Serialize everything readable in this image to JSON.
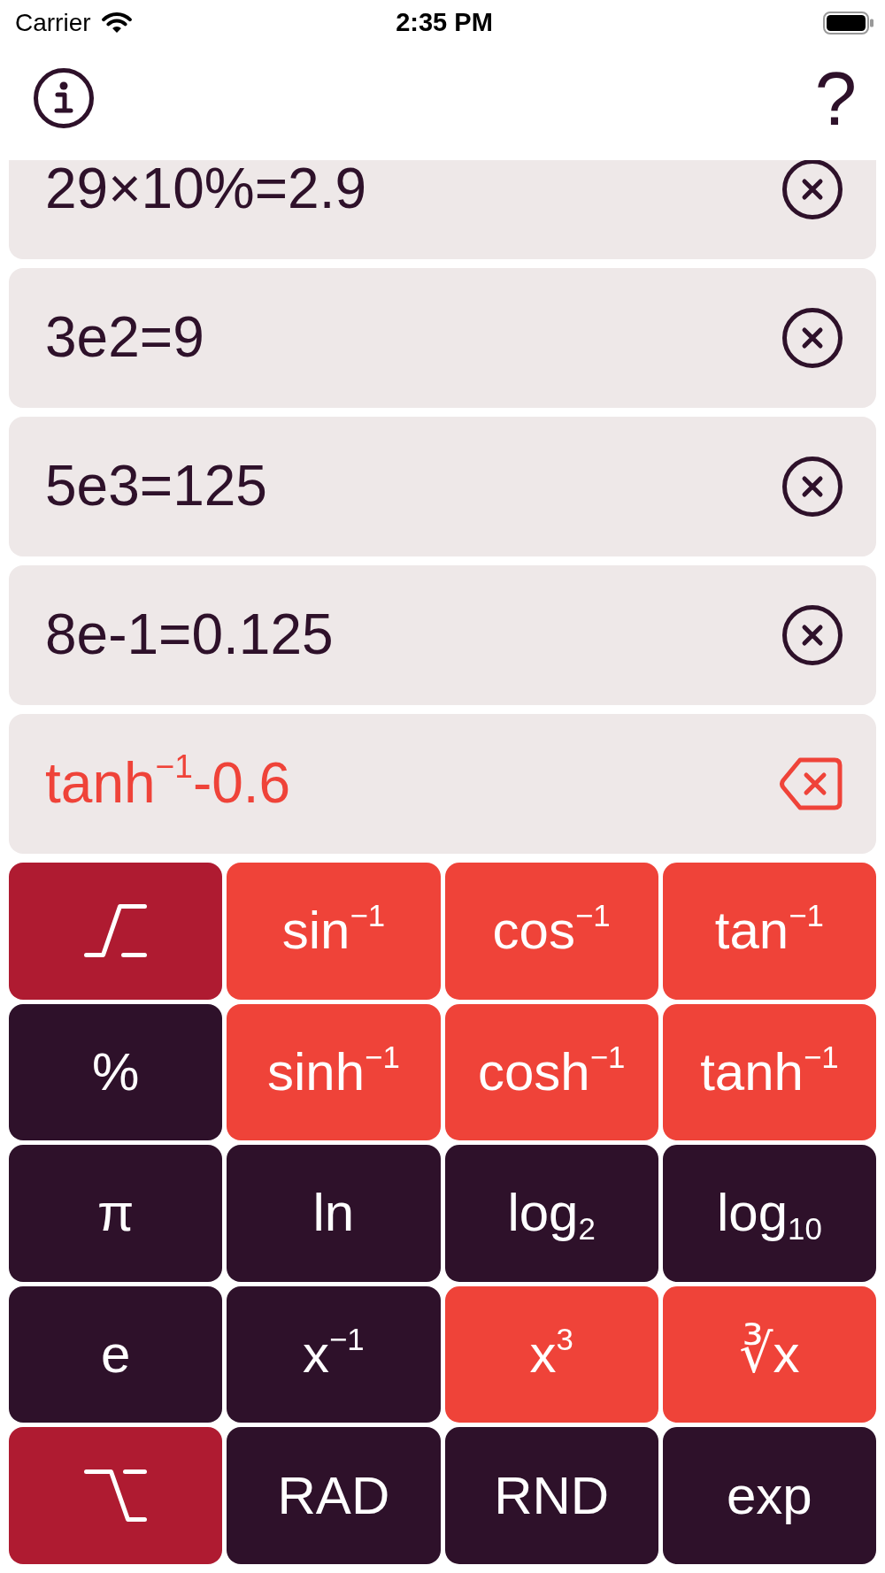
{
  "status_bar": {
    "carrier": "Carrier",
    "time": "2:35 PM"
  },
  "header": {
    "help": "?"
  },
  "history": [
    {
      "expression": "29×10%=2.9"
    },
    {
      "expression": "3e2=9"
    },
    {
      "expression": "5e3=125"
    },
    {
      "expression": "8e-1=0.125"
    }
  ],
  "input": {
    "expression": "tanh$^{−1}$-0.6"
  },
  "keypad": {
    "keys": [
      {
        "kind": "shift",
        "color": "#AF1B31"
      },
      {
        "kind": "text",
        "label": "sin$^{−1}$",
        "color": "#EF4339"
      },
      {
        "kind": "text",
        "label": "cos$^{−1}$",
        "color": "#EF4339"
      },
      {
        "kind": "text",
        "label": "tan$^{−1}$",
        "color": "#EF4339"
      },
      {
        "kind": "text",
        "label": "%",
        "color": "#2E112A"
      },
      {
        "kind": "text",
        "label": "sinh$^{−1}$",
        "color": "#EF4339"
      },
      {
        "kind": "text",
        "label": "cosh$^{−1}$",
        "color": "#EF4339"
      },
      {
        "kind": "text",
        "label": "tanh$^{−1}$",
        "color": "#EF4339"
      },
      {
        "kind": "text",
        "label": "π",
        "color": "#2E112A"
      },
      {
        "kind": "text",
        "label": "ln",
        "color": "#2E112A"
      },
      {
        "kind": "text",
        "label": "log$_{2}$",
        "color": "#2E112A"
      },
      {
        "kind": "text",
        "label": "log$_{10}$",
        "color": "#2E112A"
      },
      {
        "kind": "text",
        "label": "e",
        "color": "#2E112A"
      },
      {
        "kind": "text",
        "label": "x$^{−1}$",
        "color": "#2E112A"
      },
      {
        "kind": "text",
        "label": "x$^{3}$",
        "color": "#EF4339"
      },
      {
        "kind": "text",
        "label": "∛x",
        "color": "#EF4339"
      },
      {
        "kind": "option",
        "color": "#AF1B31"
      },
      {
        "kind": "text",
        "label": "RAD",
        "color": "#2E112A"
      },
      {
        "kind": "text",
        "label": "RND",
        "color": "#2E112A"
      },
      {
        "kind": "text",
        "label": "exp",
        "color": "#2E112A"
      }
    ]
  }
}
